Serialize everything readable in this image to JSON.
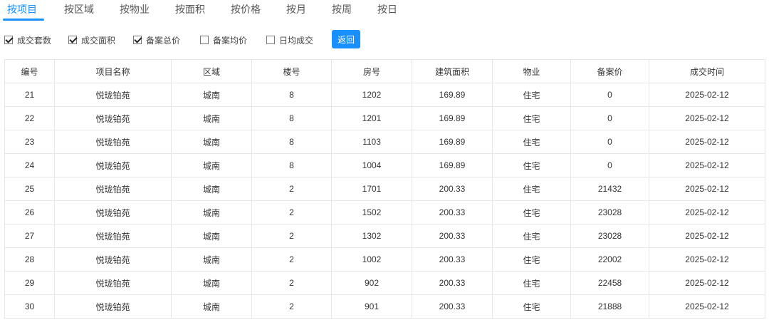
{
  "tabs": [
    {
      "label": "按项目",
      "active": true
    },
    {
      "label": "按区域"
    },
    {
      "label": "按物业"
    },
    {
      "label": "按面积"
    },
    {
      "label": "按价格"
    },
    {
      "label": "按月"
    },
    {
      "label": "按周"
    },
    {
      "label": "按日"
    }
  ],
  "filters": [
    {
      "label": "成交套数",
      "checked": true
    },
    {
      "label": "成交面积",
      "checked": true
    },
    {
      "label": "备案总价",
      "checked": true
    },
    {
      "label": "备案均价",
      "checked": false
    },
    {
      "label": "日均成交",
      "checked": false
    }
  ],
  "back_label": "返回",
  "table": {
    "headers": [
      "编号",
      "项目名称",
      "区域",
      "楼号",
      "房号",
      "建筑面积",
      "物业",
      "备案价",
      "成交时间"
    ],
    "rows": [
      [
        "21",
        "悦珑铂苑",
        "城南",
        "8",
        "1202",
        "169.89",
        "住宅",
        "0",
        "2025-02-12"
      ],
      [
        "22",
        "悦珑铂苑",
        "城南",
        "8",
        "1201",
        "169.89",
        "住宅",
        "0",
        "2025-02-12"
      ],
      [
        "23",
        "悦珑铂苑",
        "城南",
        "8",
        "1103",
        "169.89",
        "住宅",
        "0",
        "2025-02-12"
      ],
      [
        "24",
        "悦珑铂苑",
        "城南",
        "8",
        "1004",
        "169.89",
        "住宅",
        "0",
        "2025-02-12"
      ],
      [
        "25",
        "悦珑铂苑",
        "城南",
        "2",
        "1701",
        "200.33",
        "住宅",
        "21432",
        "2025-02-12"
      ],
      [
        "26",
        "悦珑铂苑",
        "城南",
        "2",
        "1502",
        "200.33",
        "住宅",
        "23028",
        "2025-02-12"
      ],
      [
        "27",
        "悦珑铂苑",
        "城南",
        "2",
        "1302",
        "200.33",
        "住宅",
        "23028",
        "2025-02-12"
      ],
      [
        "28",
        "悦珑铂苑",
        "城南",
        "2",
        "1002",
        "200.33",
        "住宅",
        "22002",
        "2025-02-12"
      ],
      [
        "29",
        "悦珑铂苑",
        "城南",
        "2",
        "902",
        "200.33",
        "住宅",
        "22458",
        "2025-02-12"
      ],
      [
        "30",
        "悦珑铂苑",
        "城南",
        "2",
        "901",
        "200.33",
        "住宅",
        "21888",
        "2025-02-12"
      ]
    ]
  },
  "colors": {
    "accent": "#1890ff",
    "border": "#e6e6e6"
  }
}
